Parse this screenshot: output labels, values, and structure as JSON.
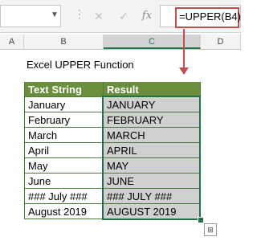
{
  "formula_bar": {
    "name_box_value": "",
    "cancel_glyph": "✕",
    "enter_glyph": "✓",
    "fx_label": "fx",
    "formula": "=UPPER(B4)"
  },
  "columns": [
    "A",
    "B",
    "C",
    "D"
  ],
  "selected_column": "C",
  "sheet": {
    "title": "Excel UPPER Function",
    "headers": {
      "text_string": "Text String",
      "result": "Result"
    },
    "rows": [
      {
        "text": "January",
        "result": "JANUARY"
      },
      {
        "text": "February",
        "result": "FEBRUARY"
      },
      {
        "text": "March",
        "result": "MARCH"
      },
      {
        "text": "April",
        "result": "APRIL"
      },
      {
        "text": "May",
        "result": "MAY"
      },
      {
        "text": "June",
        "result": "JUNE"
      },
      {
        "text": "### July ###",
        "result": "### JULY ###"
      },
      {
        "text": "August 2019",
        "result": "AUGUST 2019"
      }
    ]
  },
  "colors": {
    "header_fill": "#6a8e3c",
    "selection": "#217346",
    "arrow": "#c0504d",
    "result_fill": "#d0d0d0"
  },
  "icons": {
    "quick_analysis": "quick-analysis-icon"
  }
}
